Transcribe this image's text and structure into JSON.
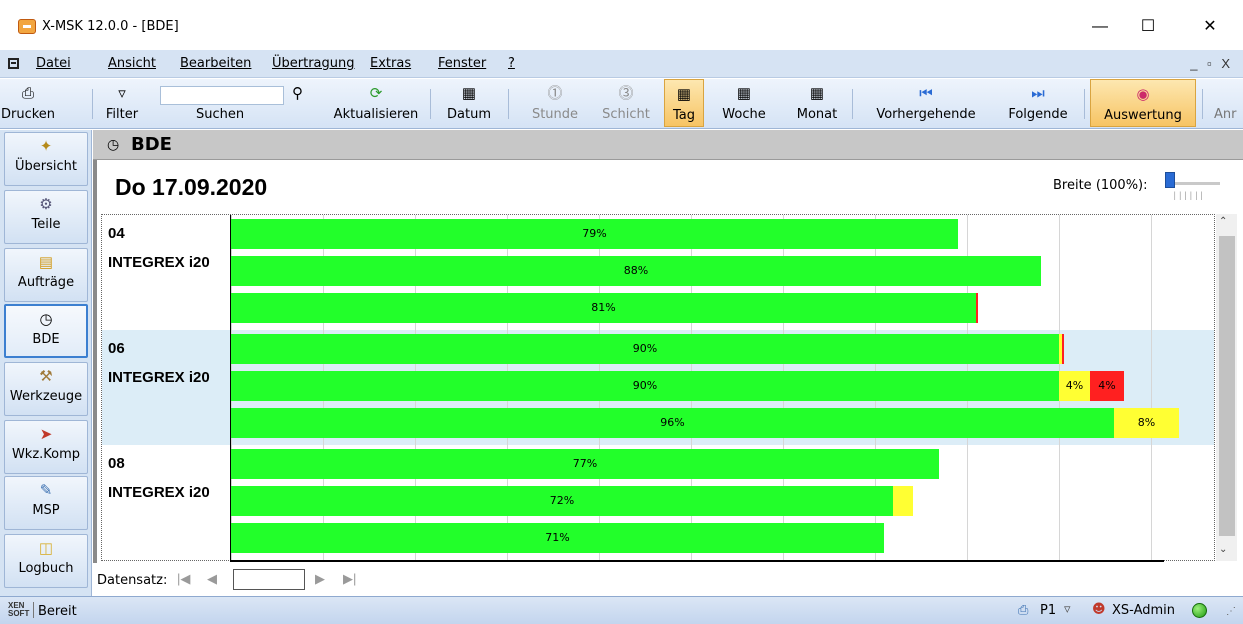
{
  "window": {
    "title": "X-MSK 12.0.0 - [BDE]",
    "minimize": "—",
    "maximize": "☐",
    "close": "✕"
  },
  "menu": {
    "items": [
      "Datei",
      "Ansicht",
      "Bearbeiten",
      "Übertragung",
      "Extras",
      "Fenster",
      "?"
    ],
    "mdi_controls": "_ ▫ X"
  },
  "toolbar": {
    "print": "Drucken",
    "filter": "Filter",
    "search": "Suchen",
    "refresh": "Aktualisieren",
    "date": "Datum",
    "hour": "Stunde",
    "shift": "Schicht",
    "day": "Tag",
    "week": "Woche",
    "month": "Monat",
    "previous": "Vorhergehende",
    "next": "Folgende",
    "evaluation": "Auswertung",
    "more": "Anr",
    "search_value": ""
  },
  "sidebar": {
    "items": [
      {
        "label": "Übersicht",
        "icon": "overview-icon"
      },
      {
        "label": "Teile",
        "icon": "parts-icon"
      },
      {
        "label": "Aufträge",
        "icon": "orders-icon"
      },
      {
        "label": "BDE",
        "icon": "clock-icon"
      },
      {
        "label": "Werkzeuge",
        "icon": "tools-icon"
      },
      {
        "label": "Wkz.Komp",
        "icon": "tool-compensation-icon"
      },
      {
        "label": "MSP",
        "icon": "msp-icon"
      },
      {
        "label": "Logbuch",
        "icon": "logbook-icon"
      }
    ],
    "active": "BDE"
  },
  "content": {
    "header_title": "BDE",
    "date": "Do 17.09.2020",
    "width_label": "Breite (100%):",
    "width_percent": 100
  },
  "chart_data": {
    "type": "bar",
    "stacked": true,
    "orientation": "horizontal",
    "colors": {
      "productive": "#22ff2a",
      "warning": "#ffff33",
      "error": "#ff2020"
    },
    "machines": [
      {
        "id": "04",
        "name": "INTEGREX i20",
        "rows": [
          {
            "segments": [
              {
                "status": "productive",
                "value": 79,
                "label": "79%"
              }
            ]
          },
          {
            "segments": [
              {
                "status": "productive",
                "value": 88,
                "label": "88%"
              }
            ]
          },
          {
            "segments": [
              {
                "status": "productive",
                "value": 81,
                "label": "81%"
              },
              {
                "status": "error",
                "value": 0.2,
                "label": ""
              }
            ]
          }
        ]
      },
      {
        "id": "06",
        "name": "INTEGREX i20",
        "rows": [
          {
            "segments": [
              {
                "status": "productive",
                "value": 90,
                "label": "90%"
              },
              {
                "status": "warning",
                "value": 0.3,
                "label": ""
              },
              {
                "status": "error",
                "value": 0.2,
                "label": ""
              }
            ]
          },
          {
            "segments": [
              {
                "status": "productive",
                "value": 90,
                "label": "90%"
              },
              {
                "status": "warning",
                "value": 3.4,
                "label": "4%"
              },
              {
                "status": "error",
                "value": 3.7,
                "label": "4%"
              }
            ]
          },
          {
            "segments": [
              {
                "status": "productive",
                "value": 96,
                "label": "96%"
              },
              {
                "status": "warning",
                "value": 7.1,
                "label": "8%"
              }
            ]
          }
        ]
      },
      {
        "id": "08",
        "name": "INTEGREX i20",
        "rows": [
          {
            "segments": [
              {
                "status": "productive",
                "value": 77,
                "label": "77%"
              }
            ]
          },
          {
            "segments": [
              {
                "status": "productive",
                "value": 72,
                "label": "72%"
              },
              {
                "status": "warning",
                "value": 2.2,
                "label": ""
              }
            ]
          },
          {
            "segments": [
              {
                "status": "productive",
                "value": 71,
                "label": "71%"
              }
            ]
          }
        ]
      }
    ],
    "xlim": [
      0,
      108
    ]
  },
  "navigator": {
    "label": "Datensatz:",
    "first": "|◀",
    "prev": "◀",
    "next": "▶",
    "last": "▶|",
    "value": ""
  },
  "status": {
    "logo": "XEN SOFT",
    "text": "Bereit",
    "printer": "P1",
    "user": "XS-Admin"
  }
}
